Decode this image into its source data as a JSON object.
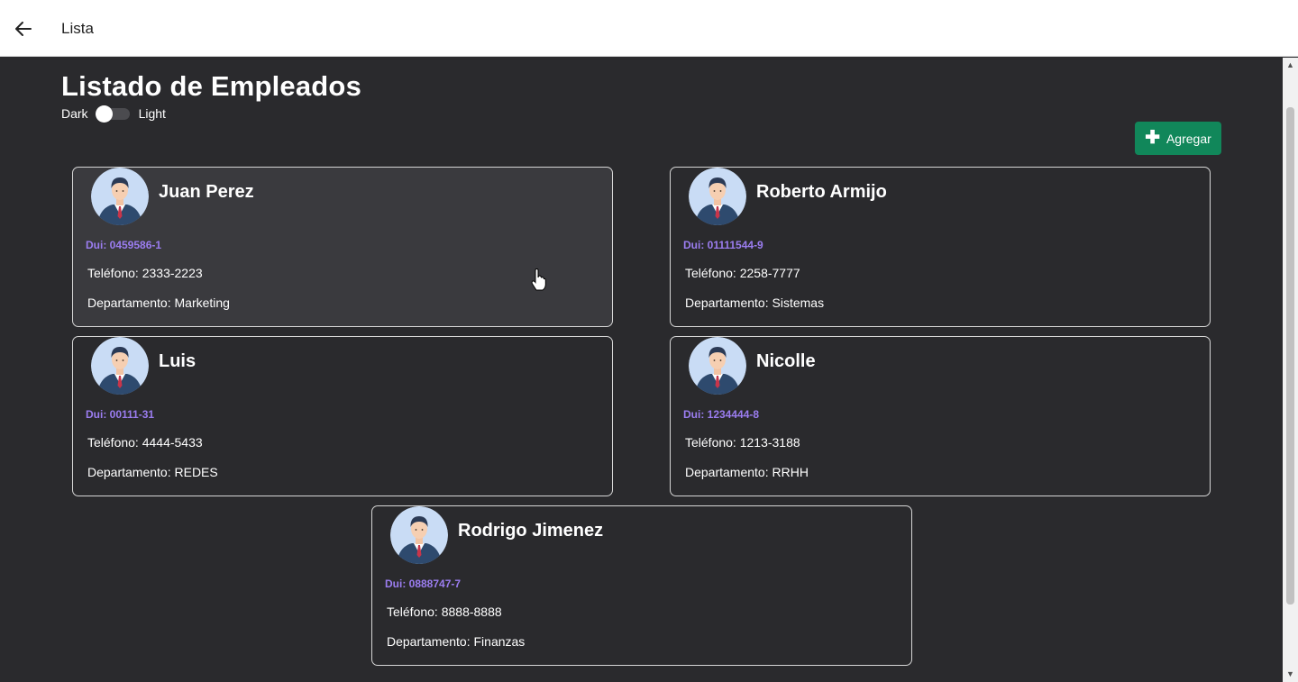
{
  "topbar": {
    "title": "Lista"
  },
  "page": {
    "heading": "Listado de Empleados",
    "theme_dark_label": "Dark",
    "theme_light_label": "Light",
    "add_button_label": "Agregar"
  },
  "icons": {
    "back": "arrow-left-icon",
    "add": "plus-icon",
    "avatar": "businessman-avatar-icon"
  },
  "colors": {
    "background": "#2a2a2d",
    "accent_green": "#11875a",
    "dui_purple": "#9b7df0"
  },
  "employees": [
    {
      "name": "Juan Perez",
      "dui": "Dui: 0459586-1",
      "phone": "Teléfono: 2333-2223",
      "department": "Departamento: Marketing"
    },
    {
      "name": "Roberto Armijo",
      "dui": "Dui: 01111544-9",
      "phone": "Teléfono: 2258-7777",
      "department": "Departamento: Sistemas"
    },
    {
      "name": "Luis",
      "dui": "Dui: 00111-31",
      "phone": "Teléfono: 4444-5433",
      "department": "Departamento: REDES"
    },
    {
      "name": "Nicolle",
      "dui": "Dui: 1234444-8",
      "phone": "Teléfono: 1213-3188",
      "department": "Departamento: RRHH"
    },
    {
      "name": "Rodrigo Jimenez",
      "dui": "Dui: 0888747-7",
      "phone": "Teléfono: 8888-8888",
      "department": "Departamento: Finanzas"
    }
  ]
}
